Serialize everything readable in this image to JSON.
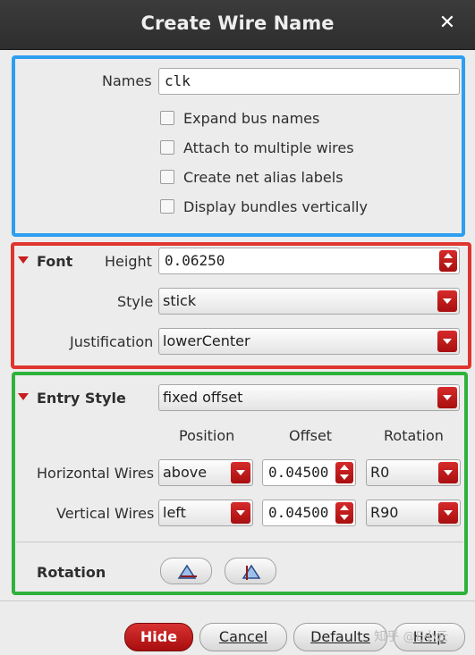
{
  "title": "Create Wire Name",
  "names": {
    "label": "Names",
    "value": "clk",
    "options": [
      {
        "label": "Expand bus names",
        "checked": false
      },
      {
        "label": "Attach to multiple wires",
        "checked": false
      },
      {
        "label": "Create net alias labels",
        "checked": false
      },
      {
        "label": "Display bundles vertically",
        "checked": false
      }
    ]
  },
  "font": {
    "section_label": "Font",
    "height_label": "Height",
    "height_value": "0.06250",
    "style_label": "Style",
    "style_value": "stick",
    "justification_label": "Justification",
    "justification_value": "lowerCenter"
  },
  "entry_style": {
    "section_label": "Entry Style",
    "value": "fixed offset",
    "col_position": "Position",
    "col_offset": "Offset",
    "col_rotation": "Rotation",
    "horizontal": {
      "label": "Horizontal Wires",
      "position": "above",
      "offset": "0.04500",
      "rotation": "R0"
    },
    "vertical": {
      "label": "Vertical Wires",
      "position": "left",
      "offset": "0.04500",
      "rotation": "R90"
    },
    "rotation_label": "Rotation"
  },
  "buttons": {
    "hide": "Hide",
    "cancel": "Cancel",
    "defaults": "Defaults",
    "help": "Help"
  },
  "watermark": "知乎 @E小云",
  "colors": {
    "accent": "#c81e1e",
    "blue_frame": "#2d9ef0",
    "red_frame": "#e0352f",
    "green_frame": "#2fb13c"
  }
}
